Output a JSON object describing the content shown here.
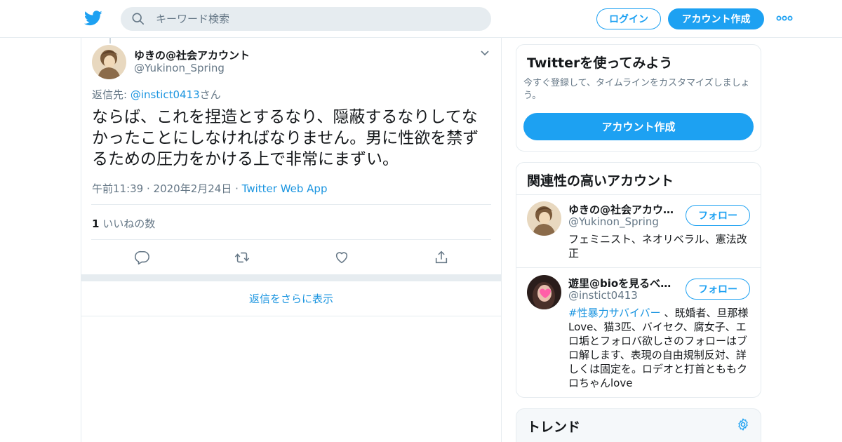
{
  "header": {
    "search_placeholder": "キーワード検索",
    "login_label": "ログイン",
    "signup_label": "アカウント作成"
  },
  "tweet": {
    "author_name": "ゆきの@社会アカウント",
    "author_handle": "@Yukinon_Spring",
    "reply_prefix": "返信先: ",
    "reply_handle": "@instict0413",
    "reply_suffix": "さん",
    "text": "ならば、これを捏造とするなり、隠蔽するなりしてなかったことにしなければなりません。男に性欲を禁ずるための圧力をかける上で非常にまずい。",
    "timestamp": "午前11:39 · 2020年2月24日",
    "separator": " · ",
    "source": "Twitter Web App",
    "like_count": "1",
    "like_label": " いいねの数"
  },
  "more_replies_label": "返信をさらに表示",
  "signup_card": {
    "title": "Twitterを使ってみよう",
    "description": "今すぐ登録して、タイムラインをカスタマイズしましょう。",
    "button_label": "アカウント作成"
  },
  "related": {
    "title": "関連性の高いアカウント",
    "accounts": [
      {
        "name": "ゆきの@社会アカウ…",
        "handle": "@Yukinon_Spring",
        "follow_label": "フォロー",
        "bio": "フェミニスト、ネオリベラル、憲法改正"
      },
      {
        "name": "遊里@bioを見るべし！",
        "handle": "@instict0413",
        "follow_label": "フォロー",
        "bio_tag": "#性暴力サバイバー",
        "bio": " 、既婚者、旦那様Love、猫3匹、バイセク、腐女子、エロ垢とフォロバ欲しさのフォローはブロ解します、表現の自由規制反対、詳しくは固定を。ロデオと打首とももクロちゃんlove"
      }
    ]
  },
  "trends": {
    "title": "トレンド"
  },
  "colors": {
    "brand": "#1da1f2",
    "link": "#1b95e0",
    "muted": "#657786",
    "border": "#e6ecf0"
  }
}
